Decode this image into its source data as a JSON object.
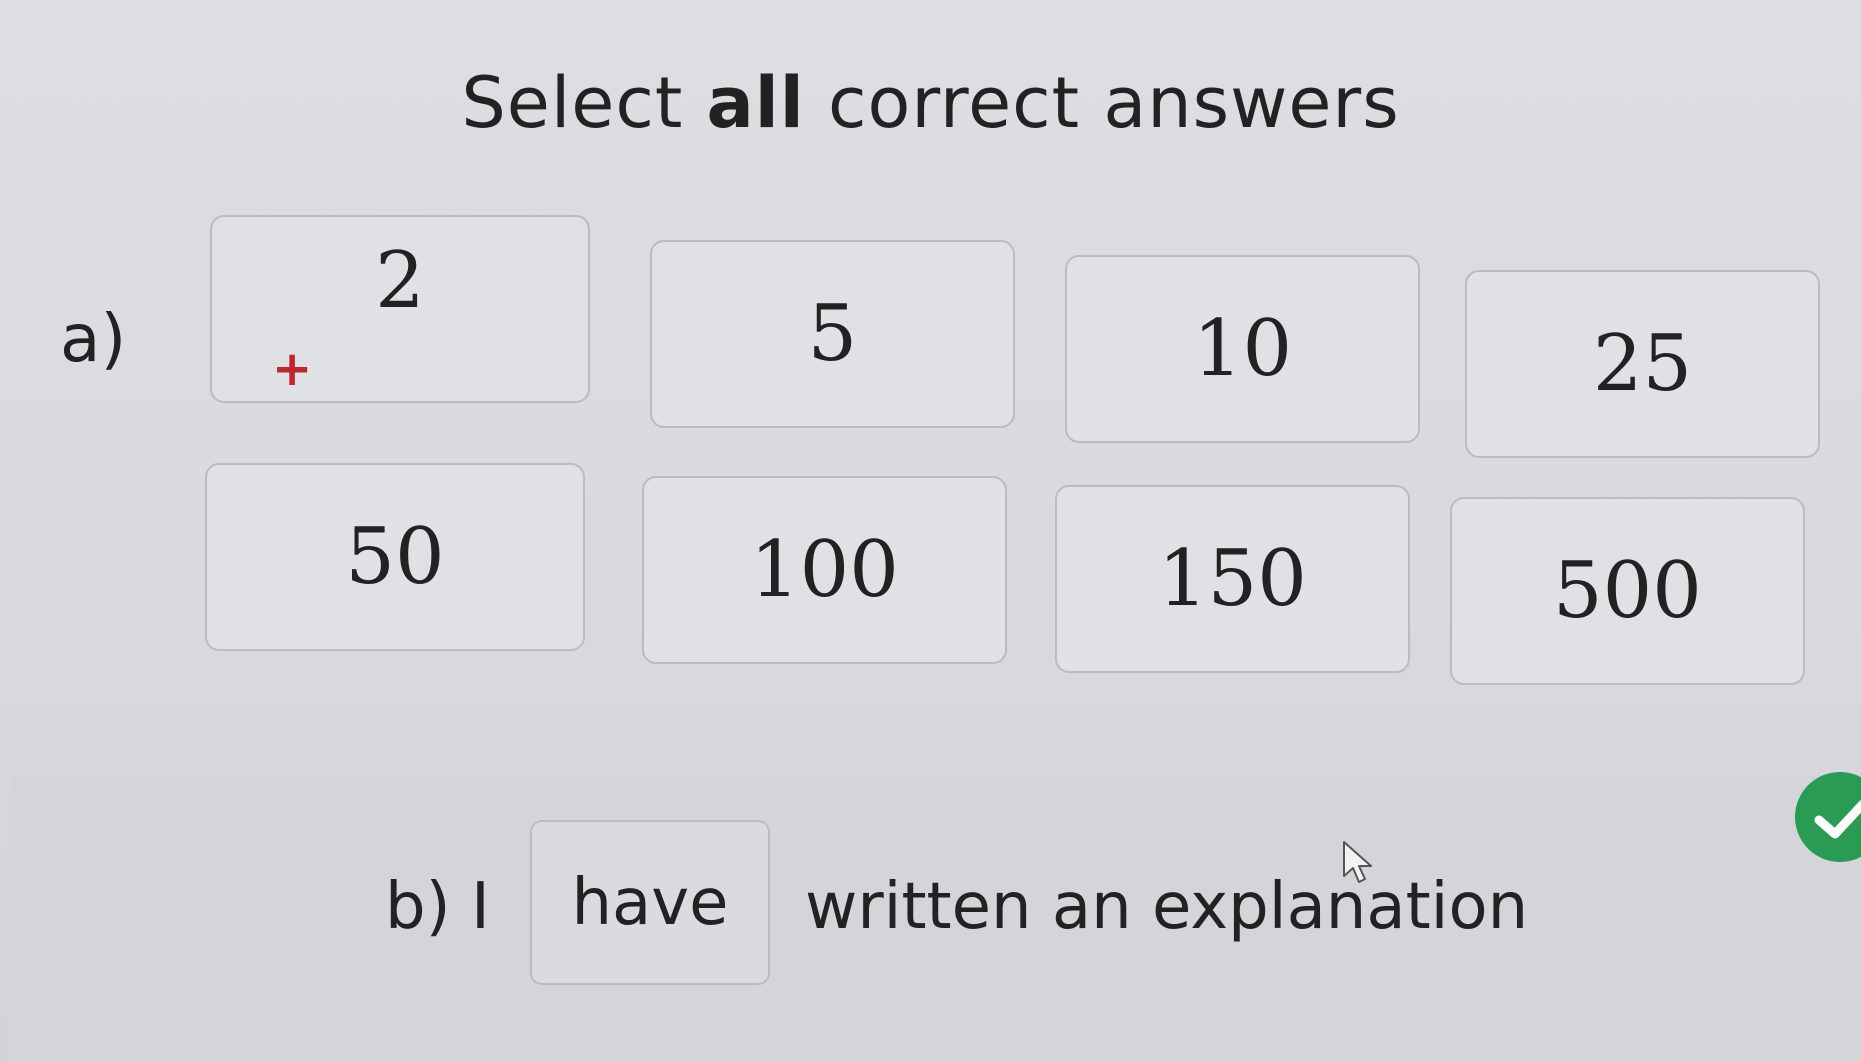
{
  "header": {
    "title_pre": "Select ",
    "title_bold": "all",
    "title_post": " correct answers"
  },
  "question_a": {
    "label": "a)",
    "marker": "+",
    "options": [
      "2",
      "5",
      "10",
      "25",
      "50",
      "100",
      "150",
      "500"
    ]
  },
  "question_b": {
    "prefix": "b) I",
    "selected": "have",
    "suffix": "written an explanation"
  },
  "colors": {
    "plus_marker": "#c0262d",
    "check_badge": "#2a9b52"
  },
  "icons": {
    "check": "check-circle-icon",
    "cursor": "mouse-pointer-icon"
  }
}
